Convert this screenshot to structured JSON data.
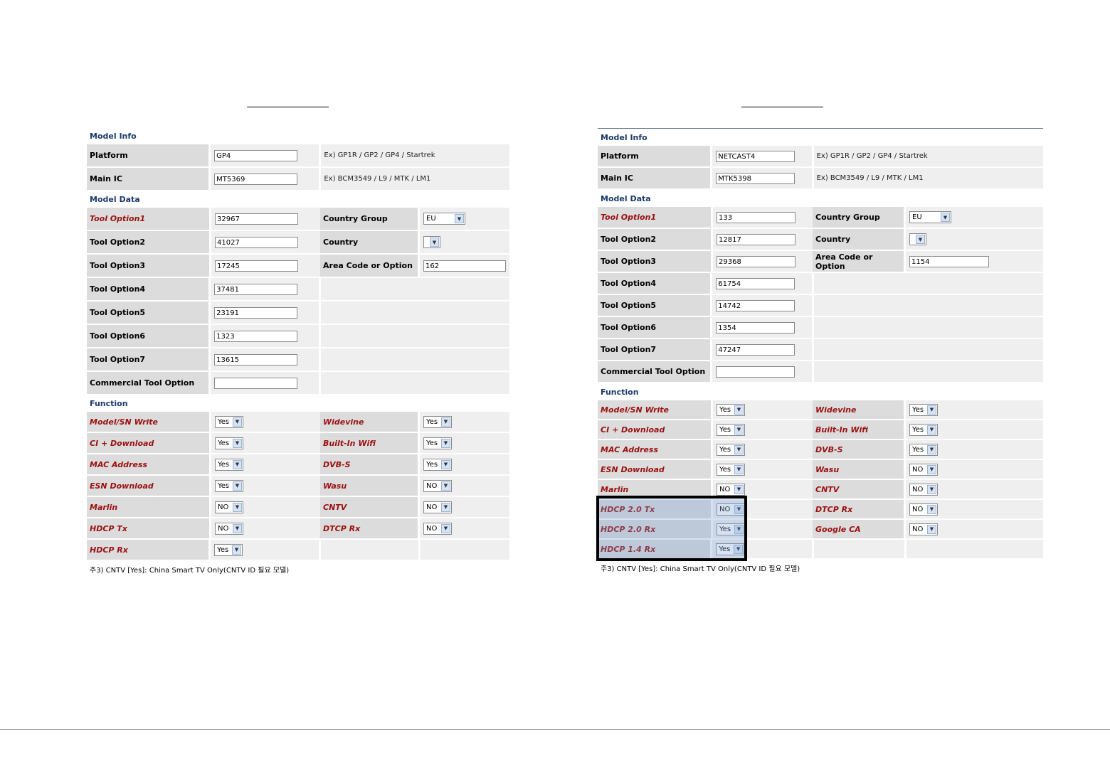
{
  "left": {
    "sections": {
      "model_info": "Model Info",
      "model_data": "Model Data",
      "function": "Function"
    },
    "platform": {
      "label": "Platform",
      "value": "GP4",
      "example": "Ex) GP1R / GP2 / GP4 / Startrek"
    },
    "main_ic": {
      "label": "Main IC",
      "value": "MT5369",
      "example": "Ex) BCM3549 / L9 / MTK / LM1"
    },
    "tool_options": [
      {
        "label": "Tool Option1",
        "value": "32967"
      },
      {
        "label": "Tool Option2",
        "value": "41027"
      },
      {
        "label": "Tool Option3",
        "value": "17245"
      },
      {
        "label": "Tool Option4",
        "value": "37481"
      },
      {
        "label": "Tool Option5",
        "value": "23191"
      },
      {
        "label": "Tool Option6",
        "value": "1323"
      },
      {
        "label": "Tool Option7",
        "value": "13615"
      },
      {
        "label": "Commercial Tool Option",
        "value": ""
      }
    ],
    "country_group": {
      "label": "Country Group",
      "value": "EU"
    },
    "country": {
      "label": "Country",
      "value": ""
    },
    "area_code": {
      "label": "Area Code or Option",
      "value": "162"
    },
    "functions": [
      {
        "label": "Model/SN Write",
        "value": "Yes",
        "label2": "Widevine",
        "value2": "Yes"
      },
      {
        "label": "CI + Download",
        "value": "Yes",
        "label2": "Built-In Wifi",
        "value2": "Yes"
      },
      {
        "label": "MAC Address",
        "value": "Yes",
        "label2": "DVB-S",
        "value2": "Yes"
      },
      {
        "label": "ESN Download",
        "value": "Yes",
        "label2": "Wasu",
        "value2": "NO"
      },
      {
        "label": "Marlin",
        "value": "NO",
        "label2": "CNTV",
        "value2": "NO"
      },
      {
        "label": "HDCP Tx",
        "value": "NO",
        "label2": "DTCP Rx",
        "value2": "NO"
      },
      {
        "label": "HDCP Rx",
        "value": "Yes"
      }
    ],
    "note": "주3) CNTV [Yes]: China Smart TV Only(CNTV ID 필요 모델)"
  },
  "right": {
    "sections": {
      "model_info": "Model Info",
      "model_data": "Model Data",
      "function": "Function"
    },
    "platform": {
      "label": "Platform",
      "value": "NETCAST4",
      "example": "Ex) GP1R / GP2 / GP4 / Startrek"
    },
    "main_ic": {
      "label": "Main IC",
      "value": "MTK5398",
      "example": "Ex) BCM3549 / L9 / MTK / LM1"
    },
    "tool_options": [
      {
        "label": "Tool Option1",
        "value": "133"
      },
      {
        "label": "Tool Option2",
        "value": "12817"
      },
      {
        "label": "Tool Option3",
        "value": "29368"
      },
      {
        "label": "Tool Option4",
        "value": "61754"
      },
      {
        "label": "Tool Option5",
        "value": "14742"
      },
      {
        "label": "Tool Option6",
        "value": "1354"
      },
      {
        "label": "Tool Option7",
        "value": "47247"
      },
      {
        "label": "Commercial Tool Option",
        "value": ""
      }
    ],
    "country_group": {
      "label": "Country Group",
      "value": "EU"
    },
    "country": {
      "label": "Country",
      "value": ""
    },
    "area_code": {
      "label": "Area Code or Option",
      "value": "1154"
    },
    "functions": [
      {
        "label": "Model/SN Write",
        "value": "Yes",
        "label2": "Widevine",
        "value2": "Yes"
      },
      {
        "label": "CI + Download",
        "value": "Yes",
        "label2": "Built-In Wifi",
        "value2": "Yes"
      },
      {
        "label": "MAC Address",
        "value": "Yes",
        "label2": "DVB-S",
        "value2": "Yes"
      },
      {
        "label": "ESN Download",
        "value": "Yes",
        "label2": "Wasu",
        "value2": "NO"
      },
      {
        "label": "Marlin",
        "value": "NO",
        "label2": "CNTV",
        "value2": "NO"
      },
      {
        "label": "HDCP 2.0 Tx",
        "value": "NO",
        "label2": "DTCP Rx",
        "value2": "NO"
      },
      {
        "label": "HDCP 2.0 Rx",
        "value": "Yes",
        "label2": "Google CA",
        "value2": "NO"
      },
      {
        "label": "HDCP 1.4 Rx",
        "value": "Yes"
      }
    ],
    "note": "주3) CNTV [Yes]: China Smart TV Only(CNTV ID 필요 모델)"
  },
  "icons": {
    "dropdown_arrow": "chevron-down-icon"
  },
  "colors": {
    "section_header": "#1b3a6b",
    "function_label": "#9b1010",
    "highlight": "#000000"
  }
}
